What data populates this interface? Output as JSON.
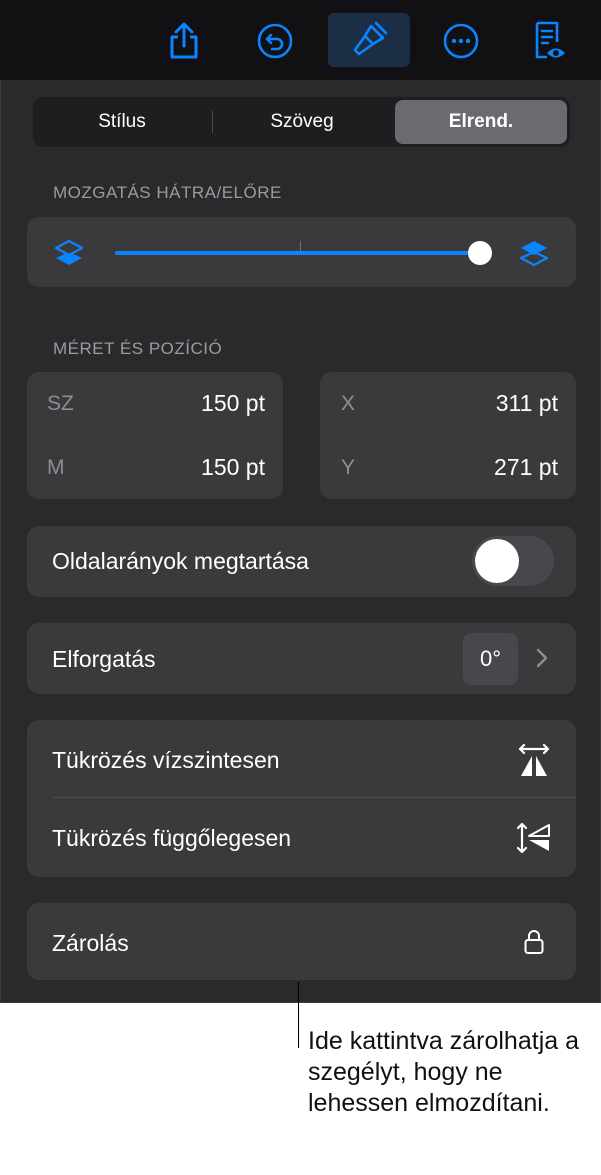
{
  "toolbar": {
    "icons": [
      "share-icon",
      "undo-icon",
      "paintbrush-icon",
      "more-icon",
      "reader-view-icon"
    ],
    "active": "paintbrush-icon",
    "accent": "#0a84ff"
  },
  "tabs": [
    {
      "label": "Stílus",
      "selected": false
    },
    {
      "label": "Szöveg",
      "selected": false
    },
    {
      "label": "Elrend.",
      "selected": true
    }
  ],
  "move": {
    "label": "MOZGATÁS HÁTRA/ELŐRE",
    "position": 1.0
  },
  "size_position": {
    "label": "MÉRET ÉS POZÍCIÓ",
    "width_label": "SZ",
    "width_value": "150 pt",
    "height_label": "M",
    "height_value": "150 pt",
    "x_label": "X",
    "x_value": "311 pt",
    "y_label": "Y",
    "y_value": "271 pt"
  },
  "constrain": {
    "label": "Oldalarányok megtartása",
    "on": false
  },
  "rotate": {
    "label": "Elforgatás",
    "value": "0°"
  },
  "flip": {
    "horizontal": "Tükrözés vízszintesen",
    "vertical": "Tükrözés függőlegesen"
  },
  "lock": {
    "label": "Zárolás"
  },
  "callout": "Ide kattintva zárolhatja a szegélyt, hogy ne lehessen elmozdítani."
}
